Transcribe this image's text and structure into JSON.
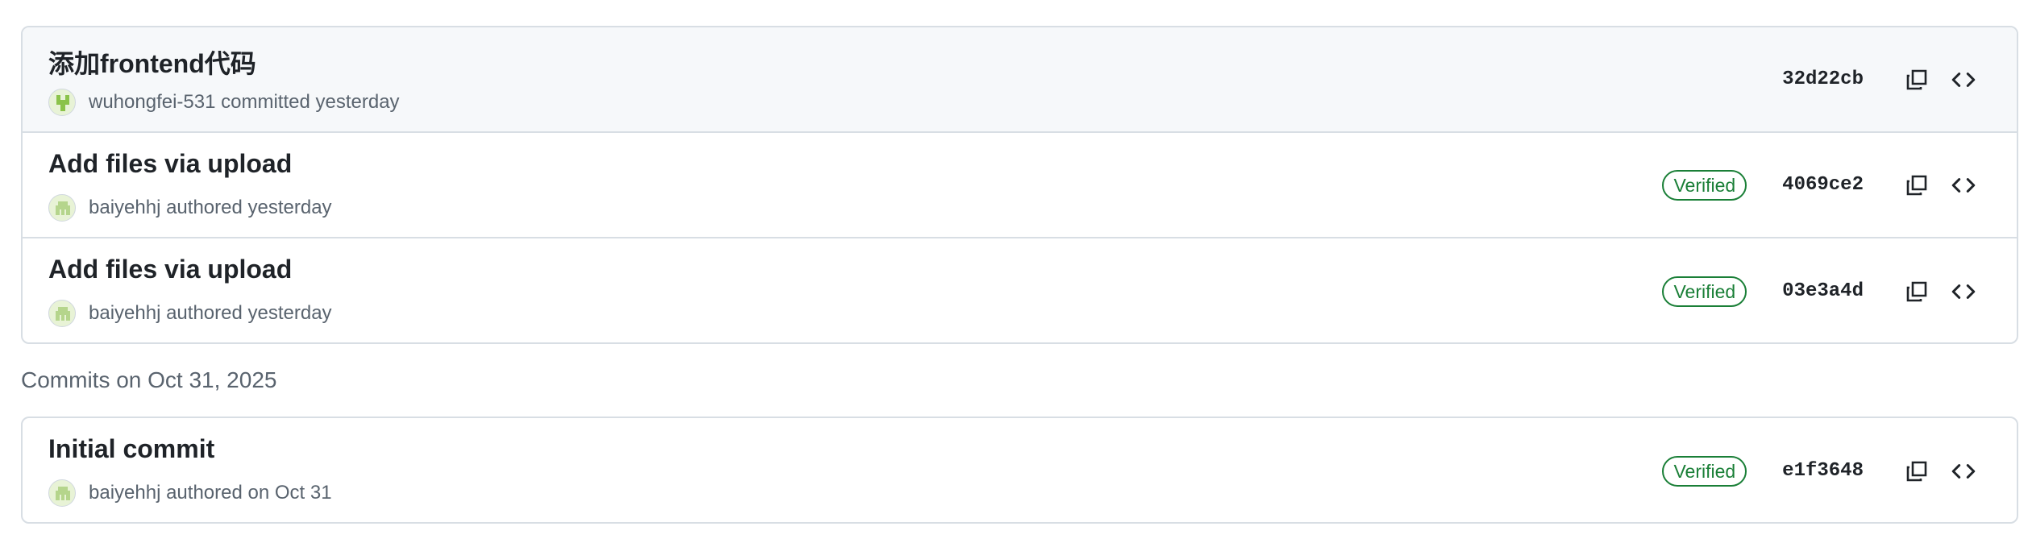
{
  "groups": [
    {
      "heading": "",
      "commits": [
        {
          "title": "添加frontend代码",
          "author": "wuhongfei-531",
          "action": "committed",
          "when": "yesterday",
          "verified": "",
          "sha": "32d22cb",
          "highlight": true,
          "avatar_color": "#8bc34a"
        },
        {
          "title": "Add files via upload",
          "author": "baiyehhj",
          "action": "authored",
          "when": "yesterday",
          "verified": "Verified",
          "sha": "4069ce2",
          "highlight": false,
          "avatar_color": "#b5d58c"
        },
        {
          "title": "Add files via upload",
          "author": "baiyehhj",
          "action": "authored",
          "when": "yesterday",
          "verified": "Verified",
          "sha": "03e3a4d",
          "highlight": false,
          "avatar_color": "#b5d58c"
        }
      ]
    },
    {
      "heading": "Commits on Oct 31, 2025",
      "commits": [
        {
          "title": "Initial commit",
          "author": "baiyehhj",
          "action": "authored",
          "when": "on Oct 31",
          "verified": "Verified",
          "sha": "e1f3648",
          "highlight": false,
          "avatar_color": "#b5d58c"
        }
      ]
    }
  ],
  "icons": {
    "copy": "copy-icon",
    "browse": "code-icon"
  },
  "colors": {
    "verified": "#1a7f37",
    "border": "#d8dee4",
    "muted": "#59636e"
  }
}
